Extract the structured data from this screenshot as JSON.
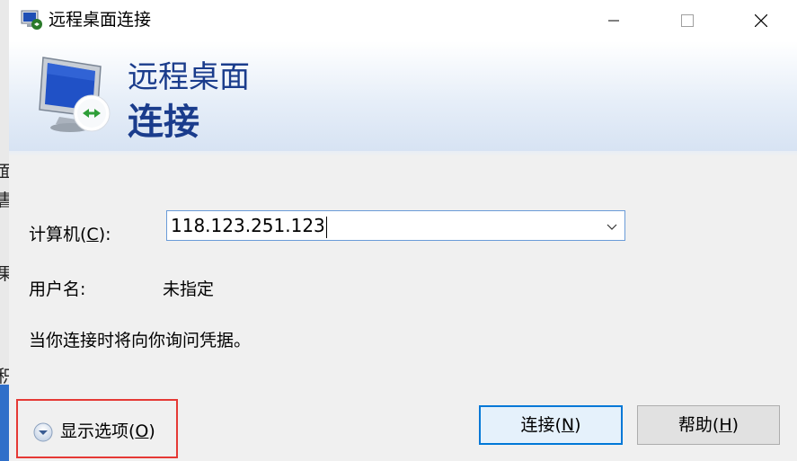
{
  "window": {
    "title": "远程桌面连接"
  },
  "banner": {
    "line1": "远程桌面",
    "line2": "连接"
  },
  "form": {
    "computer_label_prefix": "计算机(",
    "computer_label_key": "C",
    "computer_label_suffix": "):",
    "computer_value": "118.123.251.123",
    "username_label": "用户名:",
    "username_value": "未指定",
    "prompt_text": "当你连接时将向你询问凭据。"
  },
  "buttons": {
    "connect_prefix": "连接(",
    "connect_key": "N",
    "connect_suffix": ")",
    "help_prefix": "帮助(",
    "help_key": "H",
    "help_suffix": ")",
    "options_prefix": "显示选项(",
    "options_key": "O",
    "options_suffix": ")"
  },
  "background_app": {
    "fragments": [
      "面",
      "書",
      "果",
      "积"
    ]
  },
  "colors": {
    "banner_text": "#1a3c8c",
    "highlight_border": "#e53935",
    "default_button_border": "#0078d7"
  }
}
